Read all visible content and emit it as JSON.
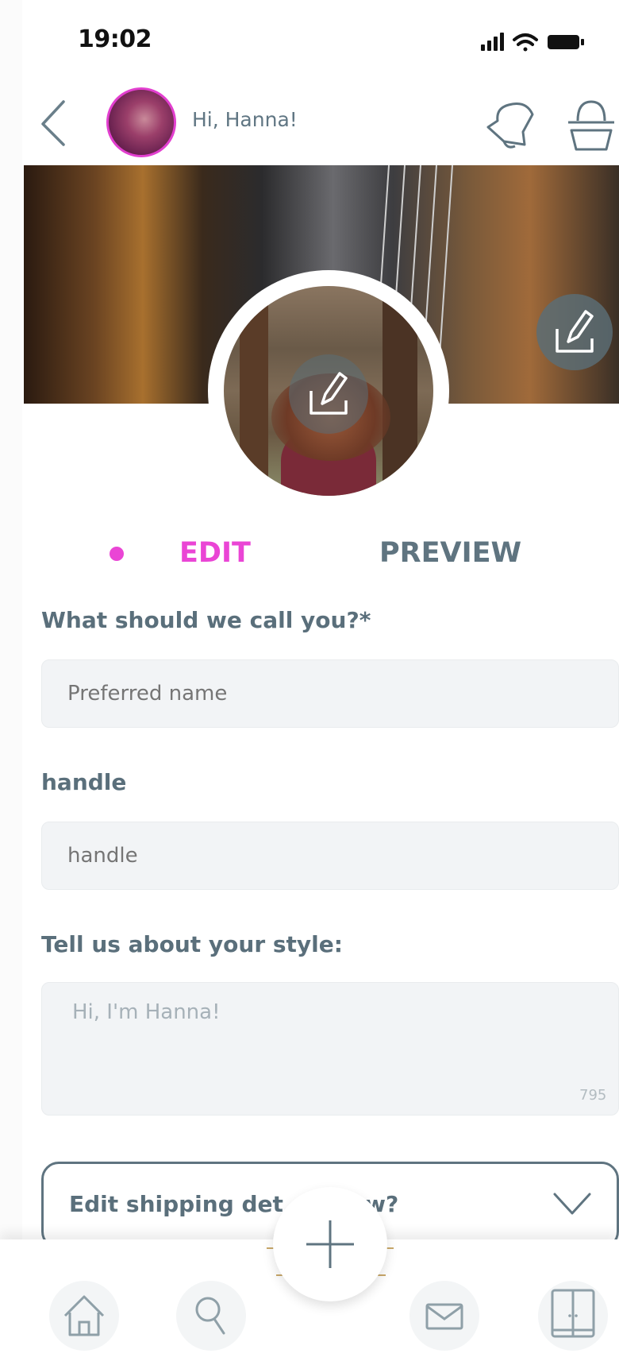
{
  "status_bar": {
    "time": "19:02"
  },
  "header": {
    "greeting": "Hi, Hanna!"
  },
  "tabs": {
    "edit": "EDIT",
    "preview": "PREVIEW",
    "active": "EDIT"
  },
  "form": {
    "name_label": "What should we call you?*",
    "name_placeholder": "Preferred name",
    "handle_label": "handle",
    "handle_placeholder": "handle",
    "style_label": "Tell us about your style:",
    "style_placeholder": "Hi, I'm Hanna!",
    "style_counter": "795",
    "shipping_label": "Edit shipping det   ow?"
  },
  "colors": {
    "accent": "#ea45d5",
    "text": "#5f7480",
    "field_bg": "#f2f4f6"
  },
  "icons": [
    "back-icon",
    "bell-icon",
    "basket-icon",
    "edit-icon",
    "chevron-down-icon",
    "plus-icon",
    "home-icon",
    "search-icon",
    "mail-icon",
    "wardrobe-icon"
  ]
}
